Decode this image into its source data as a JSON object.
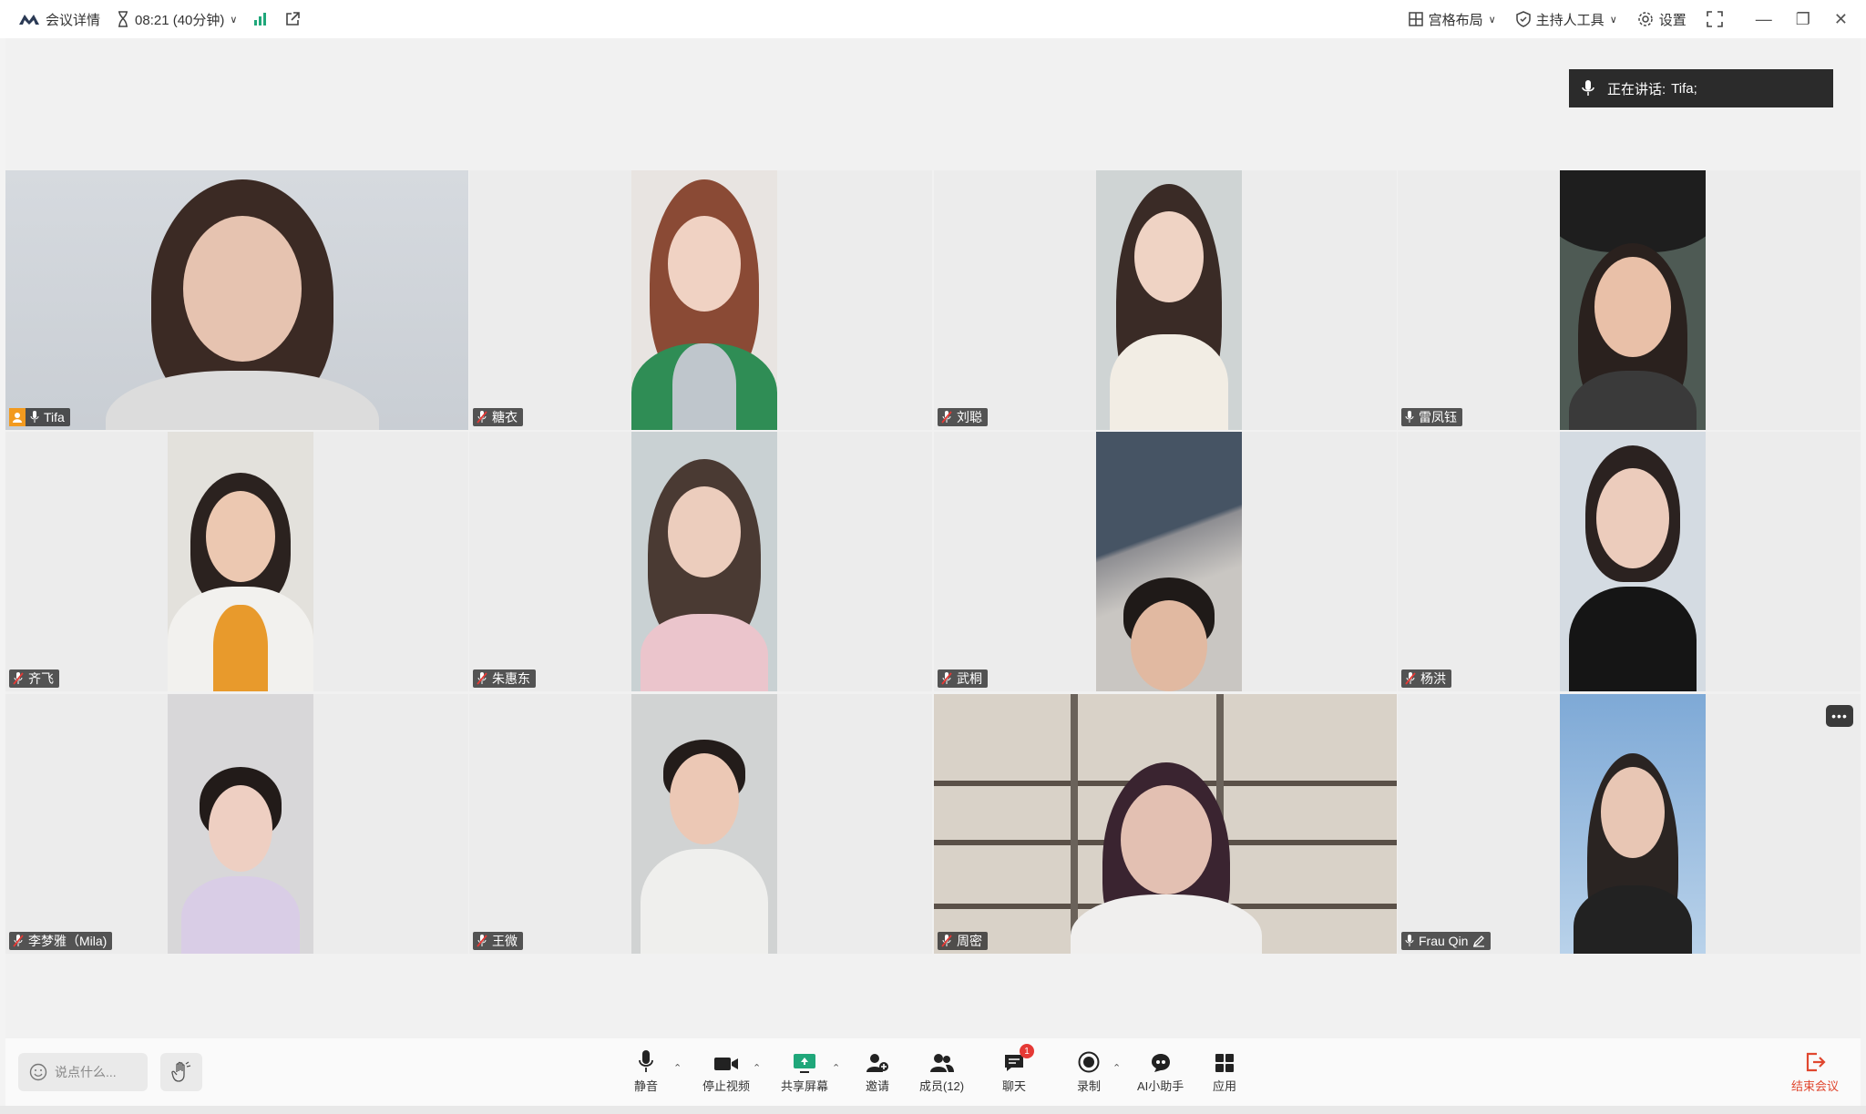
{
  "topbar": {
    "meeting_details": "会议详情",
    "timer": "08:21 (40分钟)",
    "layout": "宫格布局",
    "host_tools": "主持人工具",
    "settings": "设置"
  },
  "speaking": {
    "label": "正在讲话:",
    "name": "Tifa;"
  },
  "participants": [
    {
      "name": "Tifa",
      "mic": "on",
      "host": true
    },
    {
      "name": "糖衣",
      "mic": "muted"
    },
    {
      "name": "刘聪",
      "mic": "muted"
    },
    {
      "name": "雷凤钰",
      "mic": "on"
    },
    {
      "name": "齐飞",
      "mic": "muted"
    },
    {
      "name": "朱惠东",
      "mic": "muted"
    },
    {
      "name": "武桐",
      "mic": "muted"
    },
    {
      "name": "杨洪",
      "mic": "muted"
    },
    {
      "name": "李梦雅（Mila)",
      "mic": "muted"
    },
    {
      "name": "王微",
      "mic": "muted"
    },
    {
      "name": "周密",
      "mic": "muted"
    },
    {
      "name": "Frau Qin",
      "mic": "on",
      "editing": true
    }
  ],
  "bottombar": {
    "say_placeholder": "说点什么...",
    "mute": "静音",
    "stop_video": "停止视频",
    "share_screen": "共享屏幕",
    "invite": "邀请",
    "members": "成员(12)",
    "chat": "聊天",
    "chat_badge": "1",
    "record": "录制",
    "ai_assistant": "AI小助手",
    "apps": "应用",
    "end_meeting": "结束会议"
  },
  "colors": {
    "active_border": "#27c28a",
    "end_red": "#e0472f",
    "share_green": "#1fa77a"
  }
}
